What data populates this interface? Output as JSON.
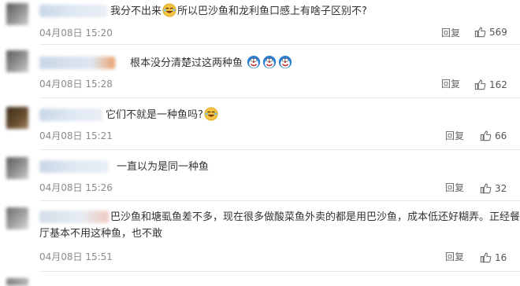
{
  "comments": [
    {
      "text_before": "我分不出来",
      "text_after": "所以巴沙鱼和龙利鱼口感上有啥子区别不?",
      "emojis": [
        "laughing-tears-emoji"
      ],
      "time": "04月08日 15:20",
      "reply": "回复",
      "likes": "569"
    },
    {
      "text_before": "根本没分清楚过这两种鱼",
      "text_after": "",
      "emojis": [
        "doraemon-emoji",
        "doraemon-emoji",
        "doraemon-emoji"
      ],
      "time": "04月08日 15:28",
      "reply": "回复",
      "likes": "162"
    },
    {
      "text_before": "它们不就是一种鱼吗?",
      "text_after": "",
      "emojis": [
        "laughing-tears-emoji"
      ],
      "time": "04月08日 15:21",
      "reply": "回复",
      "likes": "66"
    },
    {
      "text_before": "一直以为是同一种鱼",
      "text_after": "",
      "emojis": [],
      "time": "04月08日 15:26",
      "reply": "回复",
      "likes": "32"
    },
    {
      "text_line1": "巴沙鱼和塘虱鱼差不多，现在很多做酸菜鱼外卖的都是用巴沙鱼，成本低还好糊弄。正经餐",
      "text_line2": "厅基本不用这种鱼，也不敢",
      "time": "04月08日 15:51",
      "reply": "回复",
      "likes": "16"
    }
  ]
}
